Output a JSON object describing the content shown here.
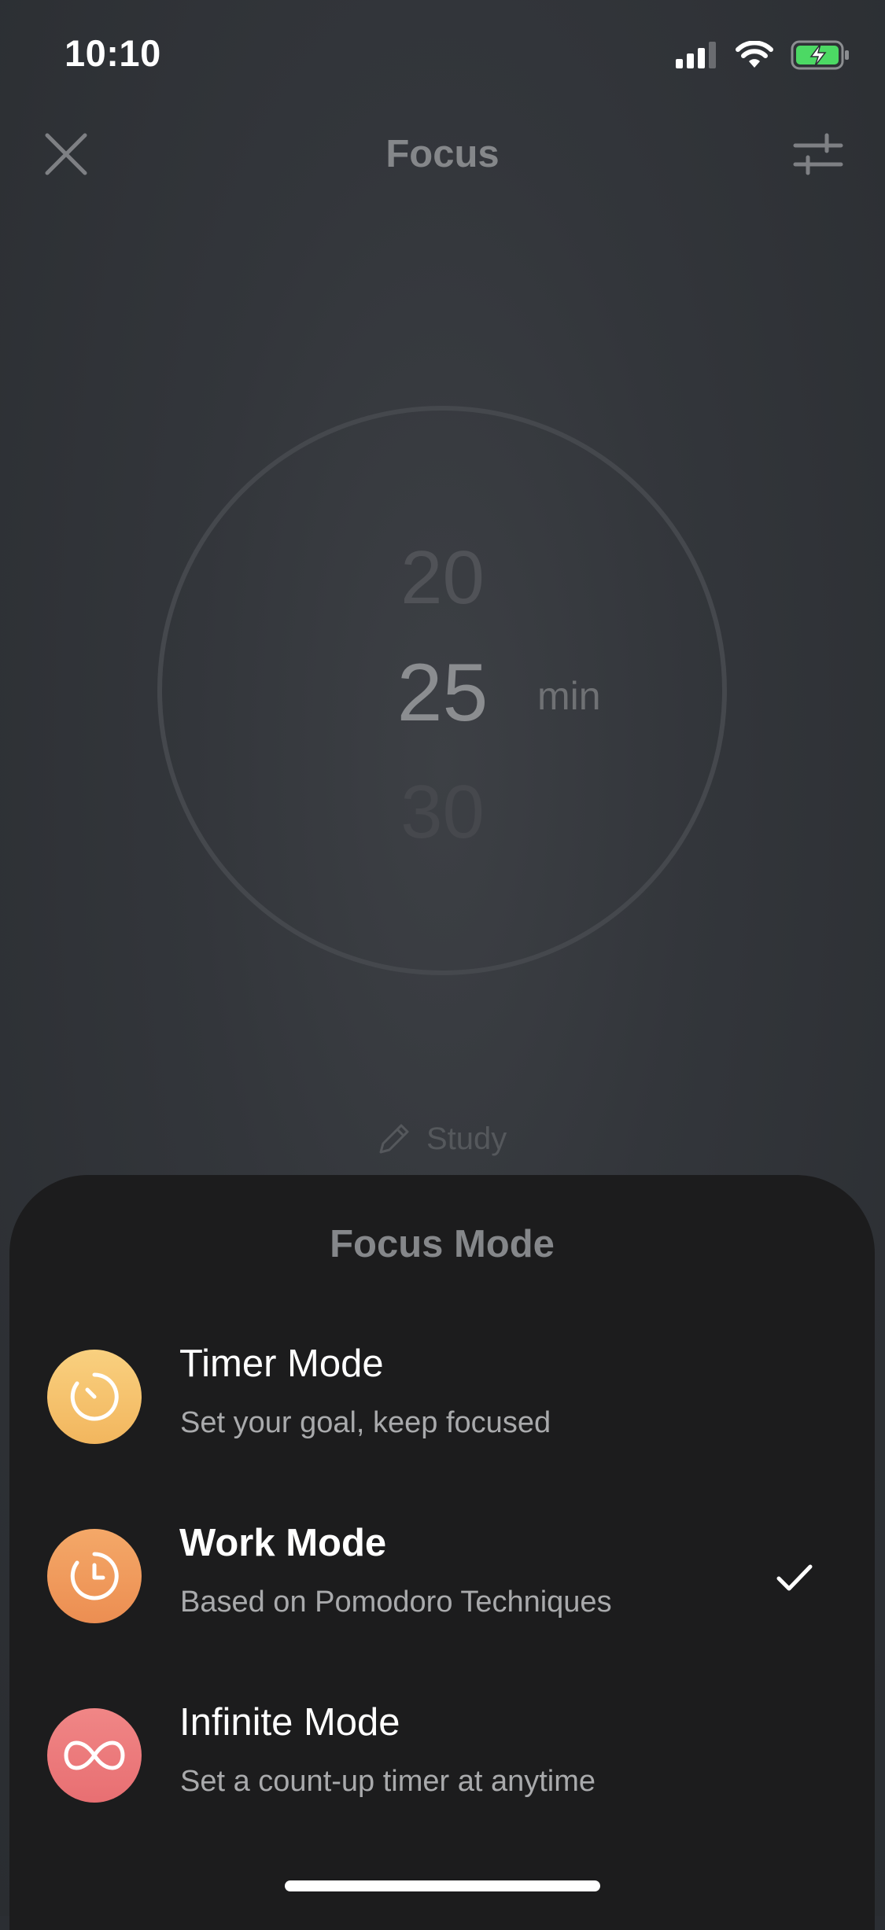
{
  "status_bar": {
    "time": "10:10",
    "battery_color": "#4cd964"
  },
  "nav": {
    "title": "Focus",
    "close_icon": "close-icon",
    "settings_icon": "sliders-icon"
  },
  "dial": {
    "previous": "20",
    "current": "25",
    "next": "30",
    "unit": "min"
  },
  "focus_label": {
    "text": "Study",
    "icon": "pencil-icon"
  },
  "sheet": {
    "title": "Focus Mode",
    "modes": [
      {
        "title": "Timer Mode",
        "description": "Set your goal, keep focused",
        "icon": "timer-icon",
        "color": "#f6c26f",
        "selected": false
      },
      {
        "title": "Work Mode",
        "description": "Based on Pomodoro Techniques",
        "icon": "clock-icon",
        "color": "#f09a5e",
        "selected": true
      },
      {
        "title": "Infinite Mode",
        "description": "Set a count-up timer at anytime",
        "icon": "infinity-icon",
        "color": "#ec7b7b",
        "selected": false
      }
    ]
  }
}
